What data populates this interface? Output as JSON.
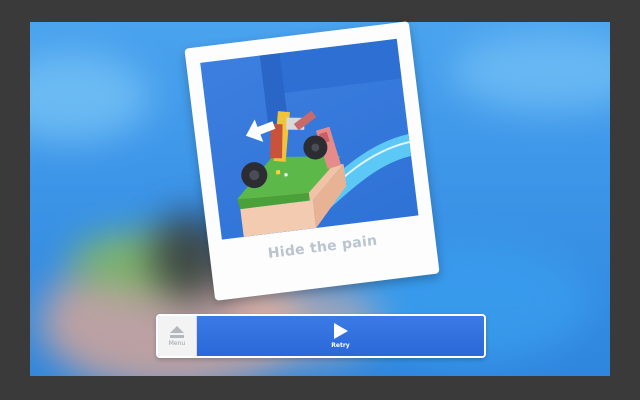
{
  "screen": {
    "caption": "Hide the pain",
    "menu_label": "Menu",
    "retry_label": "Retry"
  },
  "icons": {
    "menu": "eject-icon",
    "retry": "play-icon",
    "direction": "left-arrow-icon"
  },
  "colors": {
    "sky": "#3d95e8",
    "frame": "#fdfdfd",
    "bar": "#2f6ee0",
    "caption": "#b9c4d0"
  }
}
